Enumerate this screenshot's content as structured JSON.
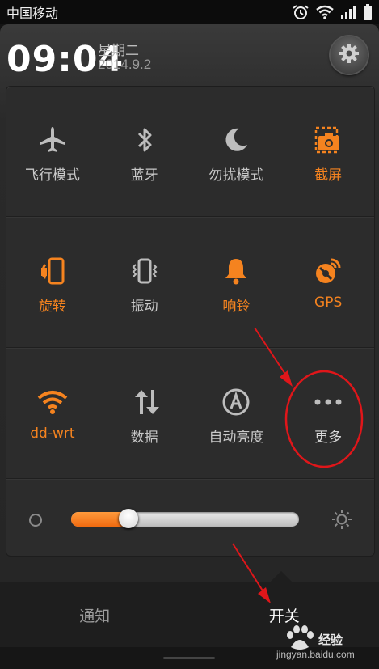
{
  "status_bar": {
    "carrier": "中国移动",
    "battery_icon": "battery-full-icon",
    "signal_icon": "signal-icon",
    "wifi_icon": "wifi-icon",
    "alarm_icon": "alarm-clock-icon"
  },
  "header": {
    "time": "09:04",
    "weekday": "星期二",
    "date": "2014.9.2",
    "settings_icon": "gear-icon"
  },
  "toggles": [
    {
      "label": "飞行模式",
      "icon": "airplane-icon",
      "state": "off"
    },
    {
      "label": "蓝牙",
      "icon": "bluetooth-icon",
      "state": "off"
    },
    {
      "label": "勿扰模式",
      "icon": "moon-icon",
      "state": "off"
    },
    {
      "label": "截屏",
      "icon": "screenshot-icon",
      "state": "on"
    },
    {
      "label": "旋转",
      "icon": "rotate-icon",
      "state": "on"
    },
    {
      "label": "振动",
      "icon": "vibrate-icon",
      "state": "off"
    },
    {
      "label": "响铃",
      "icon": "bell-icon",
      "state": "on"
    },
    {
      "label": "GPS",
      "icon": "gps-icon",
      "state": "on"
    },
    {
      "label": "dd-wrt",
      "icon": "wifi-icon",
      "state": "on"
    },
    {
      "label": "数据",
      "icon": "data-arrows-icon",
      "state": "off"
    },
    {
      "label": "自动亮度",
      "icon": "auto-brightness-icon",
      "state": "off"
    },
    {
      "label": "更多",
      "icon": "more-dots-icon",
      "state": "off"
    }
  ],
  "brightness": {
    "level": 0.25,
    "low_icon": "brightness-low-icon",
    "high_icon": "brightness-high-icon"
  },
  "tabs": [
    {
      "label": "通知",
      "active": false
    },
    {
      "label": "开关",
      "active": true
    }
  ],
  "watermark": {
    "brand": "经验",
    "url": "jingyan.baidu.com"
  },
  "colors": {
    "accent": "#f5831f",
    "inactive": "#c8c8c8",
    "annotation": "#e0161a"
  }
}
